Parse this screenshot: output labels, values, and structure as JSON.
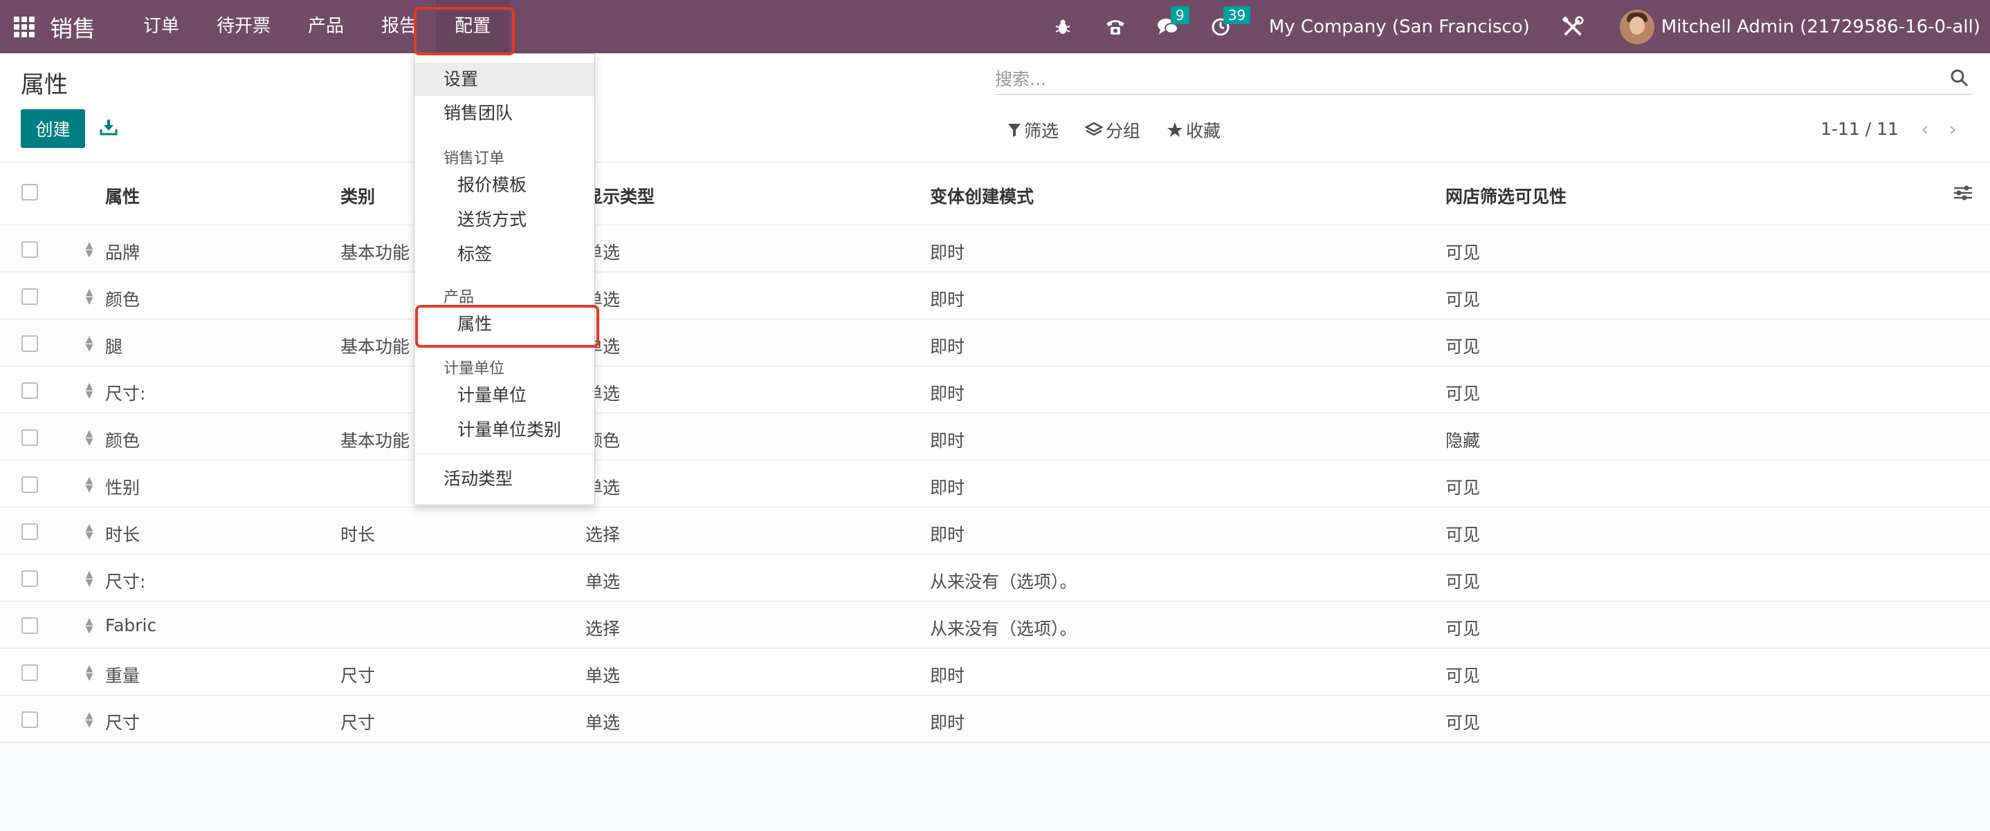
{
  "navbar": {
    "brand": "销售",
    "menu": [
      "订单",
      "待开票",
      "产品",
      "报告",
      "配置"
    ],
    "messages_badge": "9",
    "activities_badge": "39",
    "company": "My Company (San Francisco)",
    "user": "Mitchell Admin (21729586-16-0-all)"
  },
  "control": {
    "title": "属性",
    "create_label": "创建",
    "search_placeholder": "搜索...",
    "filter_label": "筛选",
    "group_label": "分组",
    "favorites_label": "收藏",
    "pager": "1-11 / 11"
  },
  "table": {
    "headers": [
      "属性",
      "类别",
      "显示类型",
      "变体创建模式",
      "网店筛选可见性"
    ],
    "rows": [
      [
        "品牌",
        "基本功能",
        "单选",
        "即时",
        "可见"
      ],
      [
        "颜色",
        "",
        "单选",
        "即时",
        "可见"
      ],
      [
        "腿",
        "基本功能",
        "单选",
        "即时",
        "可见"
      ],
      [
        "尺寸:",
        "",
        "单选",
        "即时",
        "可见"
      ],
      [
        "颜色",
        "基本功能",
        "颜色",
        "即时",
        "隐藏"
      ],
      [
        "性别",
        "",
        "单选",
        "即时",
        "可见"
      ],
      [
        "时长",
        "时长",
        "选择",
        "即时",
        "可见"
      ],
      [
        "尺寸:",
        "",
        "单选",
        "从来没有（选项）。",
        "可见"
      ],
      [
        "Fabric",
        "",
        "选择",
        "从来没有（选项）。",
        "可见"
      ],
      [
        "重量",
        "尺寸",
        "单选",
        "即时",
        "可见"
      ],
      [
        "尺寸",
        "尺寸",
        "单选",
        "即时",
        "可见"
      ]
    ]
  },
  "dropdown": {
    "settings": "设置",
    "sales_teams": "销售团队",
    "sales_orders_head": "销售订单",
    "quotation_templates": "报价模板",
    "delivery_methods": "送货方式",
    "tags": "标签",
    "products_head": "产品",
    "attributes": "属性",
    "uom_head": "计量单位",
    "uom": "计量单位",
    "uom_categories": "计量单位类别",
    "activity_types": "活动类型"
  }
}
